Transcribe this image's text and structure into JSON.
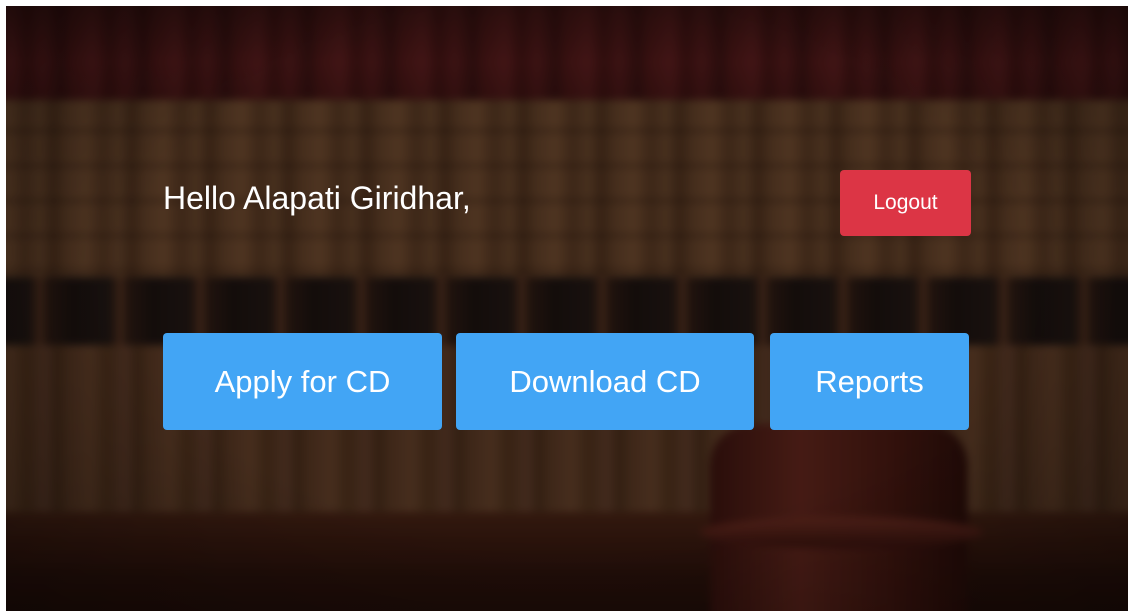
{
  "header": {
    "greeting": "Hello Alapati Giridhar,",
    "logout_label": "Logout"
  },
  "actions": [
    {
      "label": "Apply for CD"
    },
    {
      "label": "Download CD"
    },
    {
      "label": "Reports"
    }
  ],
  "colors": {
    "logout": "#dc3545",
    "action_button": "#42a5f5",
    "text": "#ffffff"
  },
  "background": {
    "image": "law-library-books-and-gavel"
  }
}
